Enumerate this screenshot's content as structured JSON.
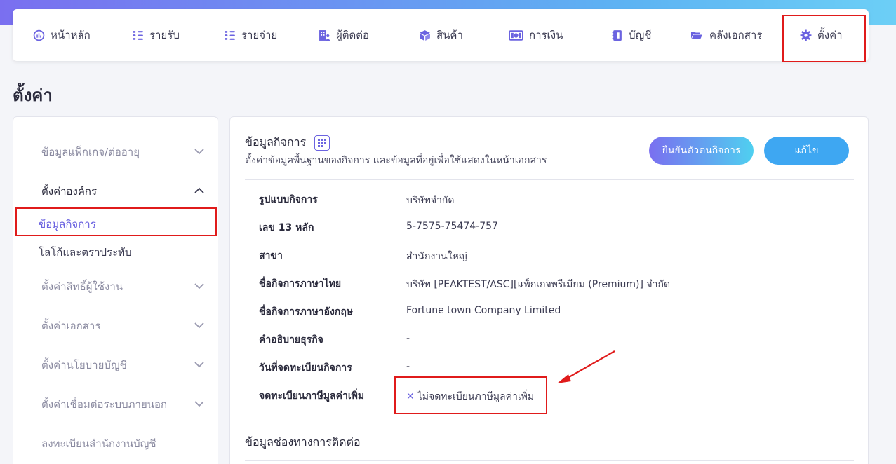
{
  "nav": {
    "items": [
      {
        "label": "หน้าหลัก",
        "icon": "dashboard-gauge-icon"
      },
      {
        "label": "รายรับ",
        "icon": "income-list-icon"
      },
      {
        "label": "รายจ่าย",
        "icon": "expense-list-icon"
      },
      {
        "label": "ผู้ติดต่อ",
        "icon": "contacts-building-icon"
      },
      {
        "label": "สินค้า",
        "icon": "product-box-icon"
      },
      {
        "label": "การเงิน",
        "icon": "money-bill-icon"
      },
      {
        "label": "บัญชี",
        "icon": "ledger-book-icon"
      },
      {
        "label": "คลังเอกสาร",
        "icon": "folder-open-icon"
      },
      {
        "label": "ตั้งค่า",
        "icon": "gear-icon"
      }
    ]
  },
  "page": {
    "title": "ตั้งค่า"
  },
  "sidebar": {
    "groups": [
      {
        "label": "ข้อมูลแพ็กเกจ/ต่ออายุ",
        "expanded": false
      },
      {
        "label": "ตั้งค่าองค์กร",
        "expanded": true
      },
      {
        "label": "ตั้งค่าสิทธิ์ผู้ใช้งาน",
        "expanded": false
      },
      {
        "label": "ตั้งค่าเอกสาร",
        "expanded": false
      },
      {
        "label": "ตั้งค่านโยบายบัญชี",
        "expanded": false
      },
      {
        "label": "ตั้งค่าเชื่อมต่อระบบภายนอก",
        "expanded": false
      },
      {
        "label": "ลงทะเบียนสำนักงานบัญชี",
        "expanded": false
      }
    ],
    "sub_items": [
      {
        "label": "ข้อมูลกิจการ",
        "selected": true
      },
      {
        "label": "โลโก้และตราประทับ",
        "selected": false
      }
    ]
  },
  "main": {
    "section_title": "ข้อมูลกิจการ",
    "section_subtitle": "ตั้งค่าข้อมูลพื้นฐานของกิจการ และข้อมูลที่อยู่เพื่อใช้แสดงในหน้าเอกสาร",
    "verify_button": "ยืนยันตัวตนกิจการ",
    "edit_button": "แก้ไข",
    "rows": [
      {
        "label": "รูปแบบกิจการ",
        "value": "บริษัทจำกัด"
      },
      {
        "label": "เลข 13 หลัก",
        "value": "5-7575-75474-757"
      },
      {
        "label": "สาขา",
        "value": "สำนักงานใหญ่"
      },
      {
        "label": "ชื่อกิจการภาษาไทย",
        "value": "บริษัท [PEAKTEST/ASC][แพ็กเกจพรีเมียม (Premium)] จำกัด"
      },
      {
        "label": "ชื่อกิจการภาษาอังกฤษ",
        "value": "Fortune town Company Limited"
      },
      {
        "label": "คำอธิบายธุรกิจ",
        "value": "-"
      },
      {
        "label": "วันที่จดทะเบียนกิจการ",
        "value": "-"
      }
    ],
    "vat": {
      "label": "จดทะเบียนภาษีมูลค่าเพิ่ม",
      "value": "ไม่จดทะเบียนภาษีมูลค่าเพิ่ม",
      "icon": "close-x-icon"
    },
    "section2_title": "ข้อมูลช่องทางการติดต่อ"
  },
  "colors": {
    "accent": "#6b63e0",
    "highlight": "#e01b1b",
    "edit_button": "#3ea7f2"
  }
}
